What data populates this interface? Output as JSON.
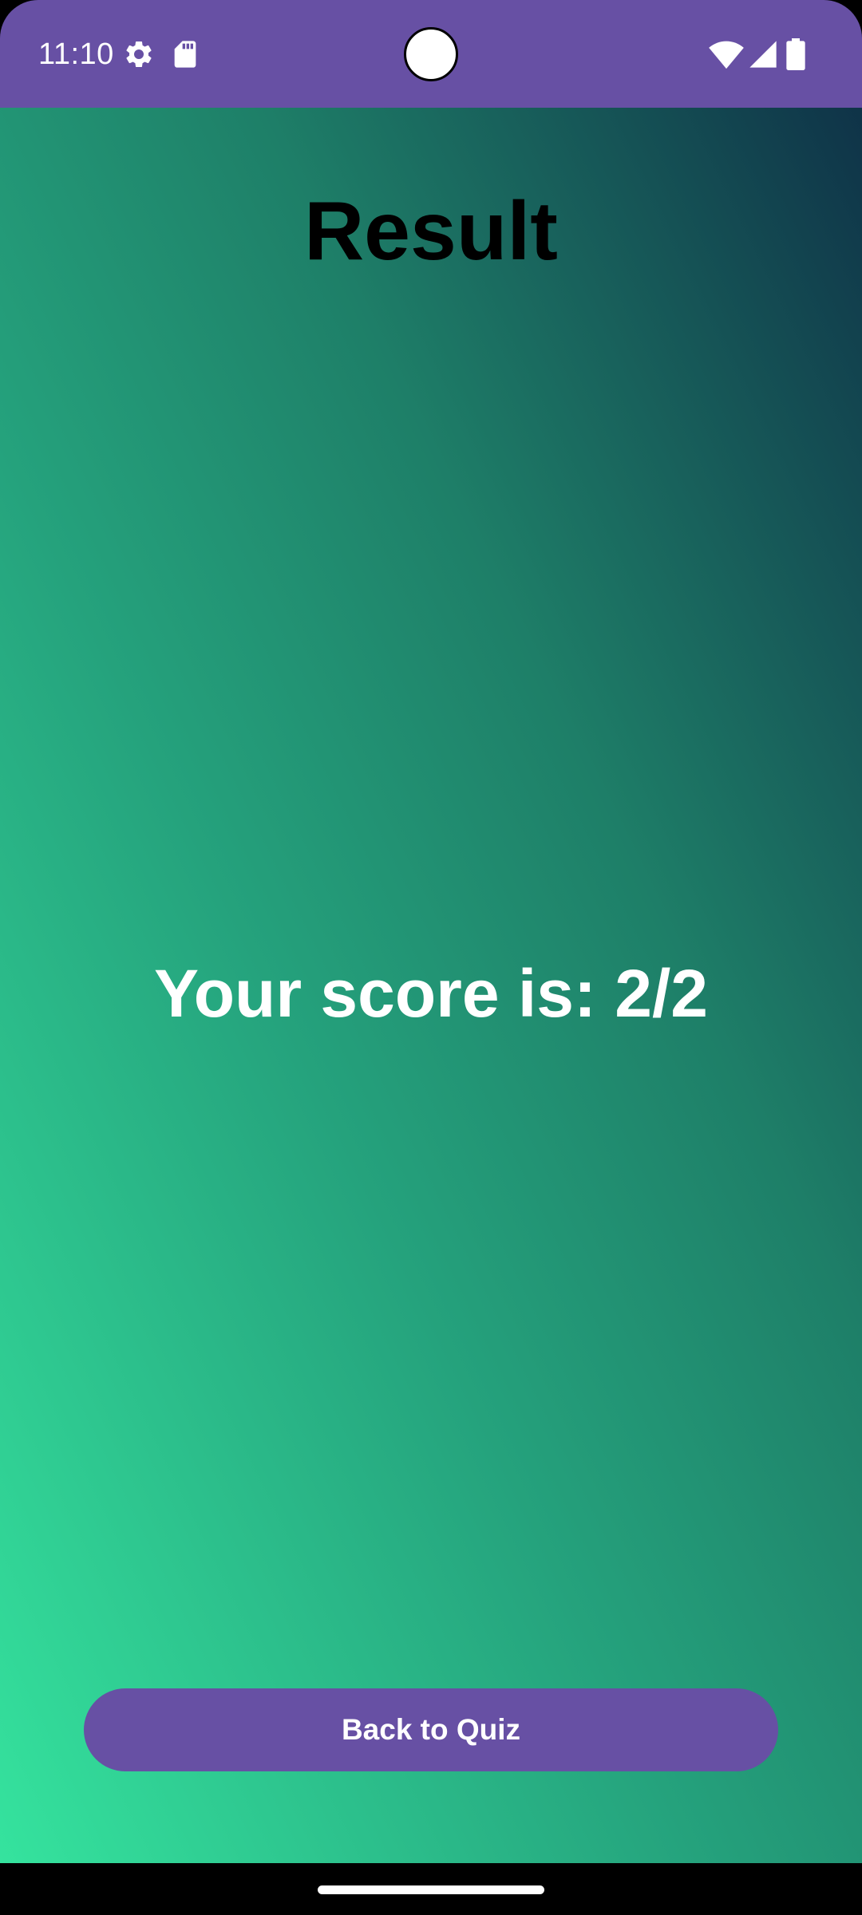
{
  "status_bar": {
    "time": "11:10",
    "color": "#6750A4",
    "icons": [
      "gear-icon",
      "sd-card-icon",
      "wifi-icon",
      "cell-signal-icon",
      "battery-icon"
    ]
  },
  "page": {
    "title": "Result",
    "score_text": "Your score is: 2/2"
  },
  "actions": {
    "back_label": "Back to Quiz"
  },
  "colors": {
    "accent": "#6750A4",
    "gradient_start": "#35E39E",
    "gradient_end": "#0F3348"
  }
}
